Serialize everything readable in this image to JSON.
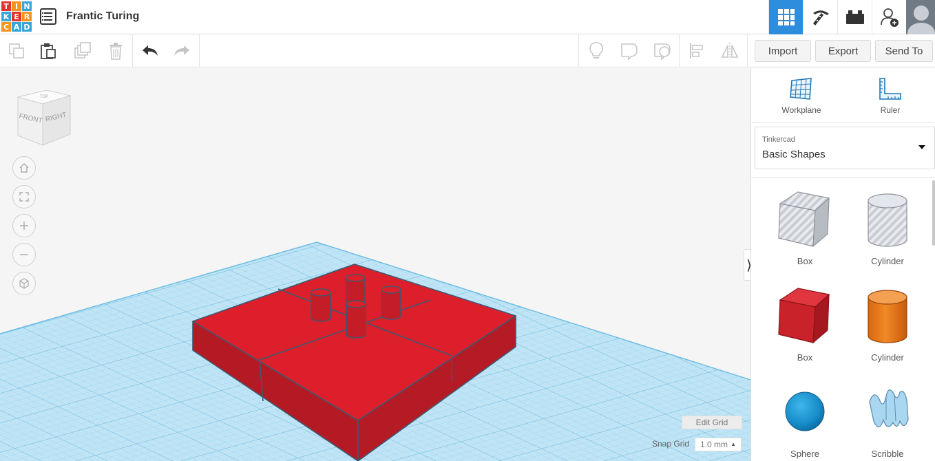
{
  "app": {
    "logo_letters": [
      "T",
      "I",
      "N",
      "K",
      "E",
      "R",
      "C",
      "A",
      "D"
    ],
    "logo_colors": [
      "#e2342e",
      "#f7931e",
      "#3aa3d8",
      "#3aa3d8",
      "#e2342e",
      "#f7931e",
      "#f7931e",
      "#3aa3d8",
      "#3aa3d8"
    ],
    "title": "Frantic Turing"
  },
  "header": {
    "views": [
      {
        "name": "3d-design-view",
        "icon": "grid-icon",
        "active": true
      },
      {
        "name": "circuits-view",
        "icon": "pickaxe-icon",
        "active": false
      },
      {
        "name": "bricks-view",
        "icon": "brick-icon",
        "active": false
      },
      {
        "name": "invite-user",
        "icon": "add-user-icon",
        "active": false
      }
    ]
  },
  "toolbar": {
    "tools": [
      "copy-icon",
      "paste-icon",
      "duplicate-icon",
      "delete-icon",
      "undo-icon",
      "redo-icon",
      "notes-icon",
      "comment-icon",
      "show-hide-icon",
      "align-icon",
      "mirror-icon"
    ],
    "import_label": "Import",
    "export_label": "Export",
    "send_to_label": "Send To"
  },
  "viewcube": {
    "front_label": "FRONT",
    "right_label": "RIGHT",
    "top_label": "TOP"
  },
  "view_controls": [
    "home-icon",
    "fit-view-icon",
    "zoom-in-icon",
    "zoom-out-icon",
    "perspective-icon"
  ],
  "grid": {
    "edit_label": "Edit Grid",
    "snap_label": "Snap Grid",
    "snap_value": "1.0 mm"
  },
  "panel": {
    "workplane_label": "Workplane",
    "ruler_label": "Ruler",
    "library_source": "Tinkercad",
    "library_name": "Basic Shapes",
    "shapes": [
      {
        "name": "Box",
        "style": "hole"
      },
      {
        "name": "Cylinder",
        "style": "hole"
      },
      {
        "name": "Box",
        "style": "solid",
        "color": "#d0262d"
      },
      {
        "name": "Cylinder",
        "style": "solid",
        "color": "#e8791e"
      },
      {
        "name": "Sphere",
        "style": "solid",
        "color": "#1b9ad6"
      },
      {
        "name": "Scribble",
        "style": "solid",
        "color": "#9fd0ee"
      }
    ]
  },
  "colors": {
    "accent": "#2e8ddc",
    "model_red": "#dc1f2a",
    "model_red_dark": "#b31a24",
    "grid_blue": "#9fd4ee"
  }
}
